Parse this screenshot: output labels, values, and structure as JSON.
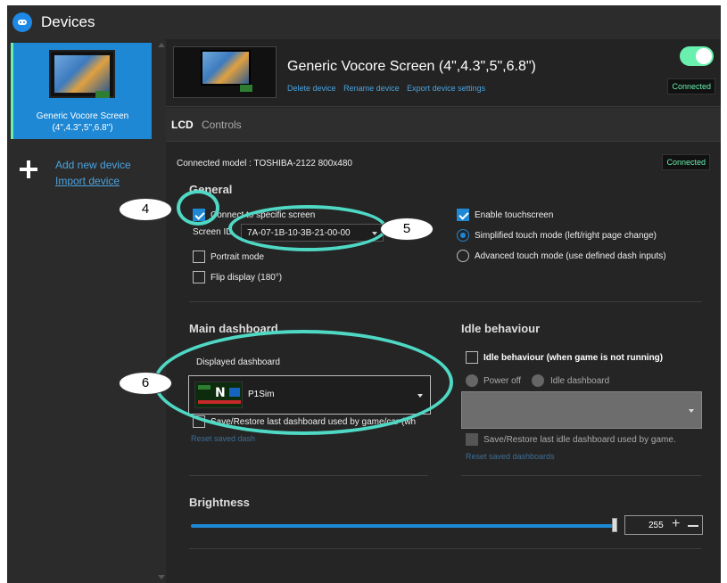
{
  "app": {
    "title": "Devices"
  },
  "sidebar": {
    "selected_device": {
      "label": "Generic Vocore Screen (4\",4.3\",5\",6.8\")"
    },
    "add_device_label": "Add new device",
    "import_device_label": "Import device"
  },
  "header": {
    "device_title": "Generic Vocore Screen (4\",4.3\",5\",6.8\")",
    "links": [
      "Delete device",
      "Rename device",
      "Export device settings"
    ],
    "status": "Connected"
  },
  "tabs": [
    "LCD",
    "Controls"
  ],
  "lcd": {
    "connected_model": "Connected model : TOSHIBA-2122 800x480",
    "status": "Connected",
    "general": {
      "title": "General",
      "connect_specific_label": "Connect to specific screen",
      "screen_id_label": "Screen ID",
      "screen_id_value": "7A-07-1B-10-3B-21-00-00",
      "portrait_label": "Portrait mode",
      "flip_label": "Flip display (180°)",
      "enable_touch_label": "Enable touchscreen",
      "simplified_touch_label": "Simplified touch mode (left/right page change)",
      "advanced_touch_label": "Advanced touch mode (use defined dash inputs)"
    },
    "main_dashboard": {
      "title": "Main dashboard",
      "displayed_label": "Displayed dashboard",
      "selected": "P1Sim",
      "save_restore_label": "Save/Restore last dashboard used by game/car (wh",
      "reset_label": "Reset saved dash"
    },
    "idle": {
      "title": "Idle behaviour",
      "enable_label": "Idle behaviour (when game is not running)",
      "power_off_label": "Power off",
      "idle_dashboard_label": "Idle dashboard",
      "save_restore_label": "Save/Restore last idle dashboard used by game.",
      "reset_label": "Reset saved dashboards"
    },
    "brightness": {
      "title": "Brightness",
      "value": "255",
      "level_fraction": 1.0
    }
  },
  "annotations": [
    "4",
    "5",
    "6"
  ],
  "colors": {
    "accent": "#1e88d4",
    "connected": "#69f0ae",
    "annotation": "#4fd8c4"
  }
}
